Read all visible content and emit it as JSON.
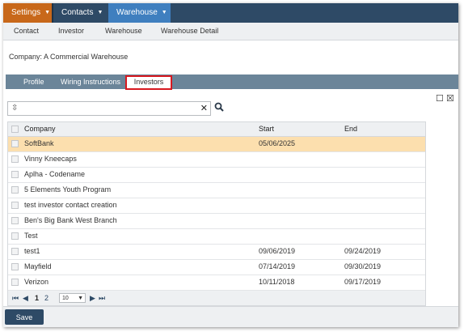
{
  "topnav": {
    "settings": "Settings",
    "contacts": "Contacts",
    "warehouse": "Warehouse"
  },
  "subnav": [
    "Contact",
    "Investor",
    "Warehouse",
    "Warehouse Detail"
  ],
  "company_label": "Company: A Commercial Warehouse",
  "tabs": {
    "profile": "Profile",
    "wiring": "Wiring Instructions",
    "investors": "Investors"
  },
  "search": {
    "value": "",
    "placeholder": ""
  },
  "grid": {
    "headers": {
      "company": "Company",
      "start": "Start",
      "end": "End"
    },
    "rows": [
      {
        "company": "SoftBank",
        "start": "05/06/2025",
        "end": ""
      },
      {
        "company": "Vinny Kneecaps",
        "start": "",
        "end": ""
      },
      {
        "company": "Aplha - Codename",
        "start": "",
        "end": ""
      },
      {
        "company": "5 Elements Youth Program",
        "start": "",
        "end": ""
      },
      {
        "company": "test investor contact creation",
        "start": "",
        "end": ""
      },
      {
        "company": "Ben's Big Bank West Branch",
        "start": "",
        "end": ""
      },
      {
        "company": "Test",
        "start": "",
        "end": ""
      },
      {
        "company": "test1",
        "start": "09/06/2019",
        "end": "09/24/2019"
      },
      {
        "company": "Mayfield",
        "start": "07/14/2019",
        "end": "09/30/2019"
      },
      {
        "company": "Verizon",
        "start": "10/11/2018",
        "end": "09/17/2019"
      }
    ]
  },
  "pager": {
    "page1": "1",
    "page2": "2",
    "page_size": "10"
  },
  "footer": {
    "save_label": "Save"
  },
  "colors": {
    "nav_dark": "#2e4a66",
    "settings_orange": "#c8681a",
    "warehouse_blue": "#3f7fbf",
    "tab_bar": "#6b8599",
    "selected_row": "#fcdfae",
    "highlight_red": "#d71920"
  }
}
